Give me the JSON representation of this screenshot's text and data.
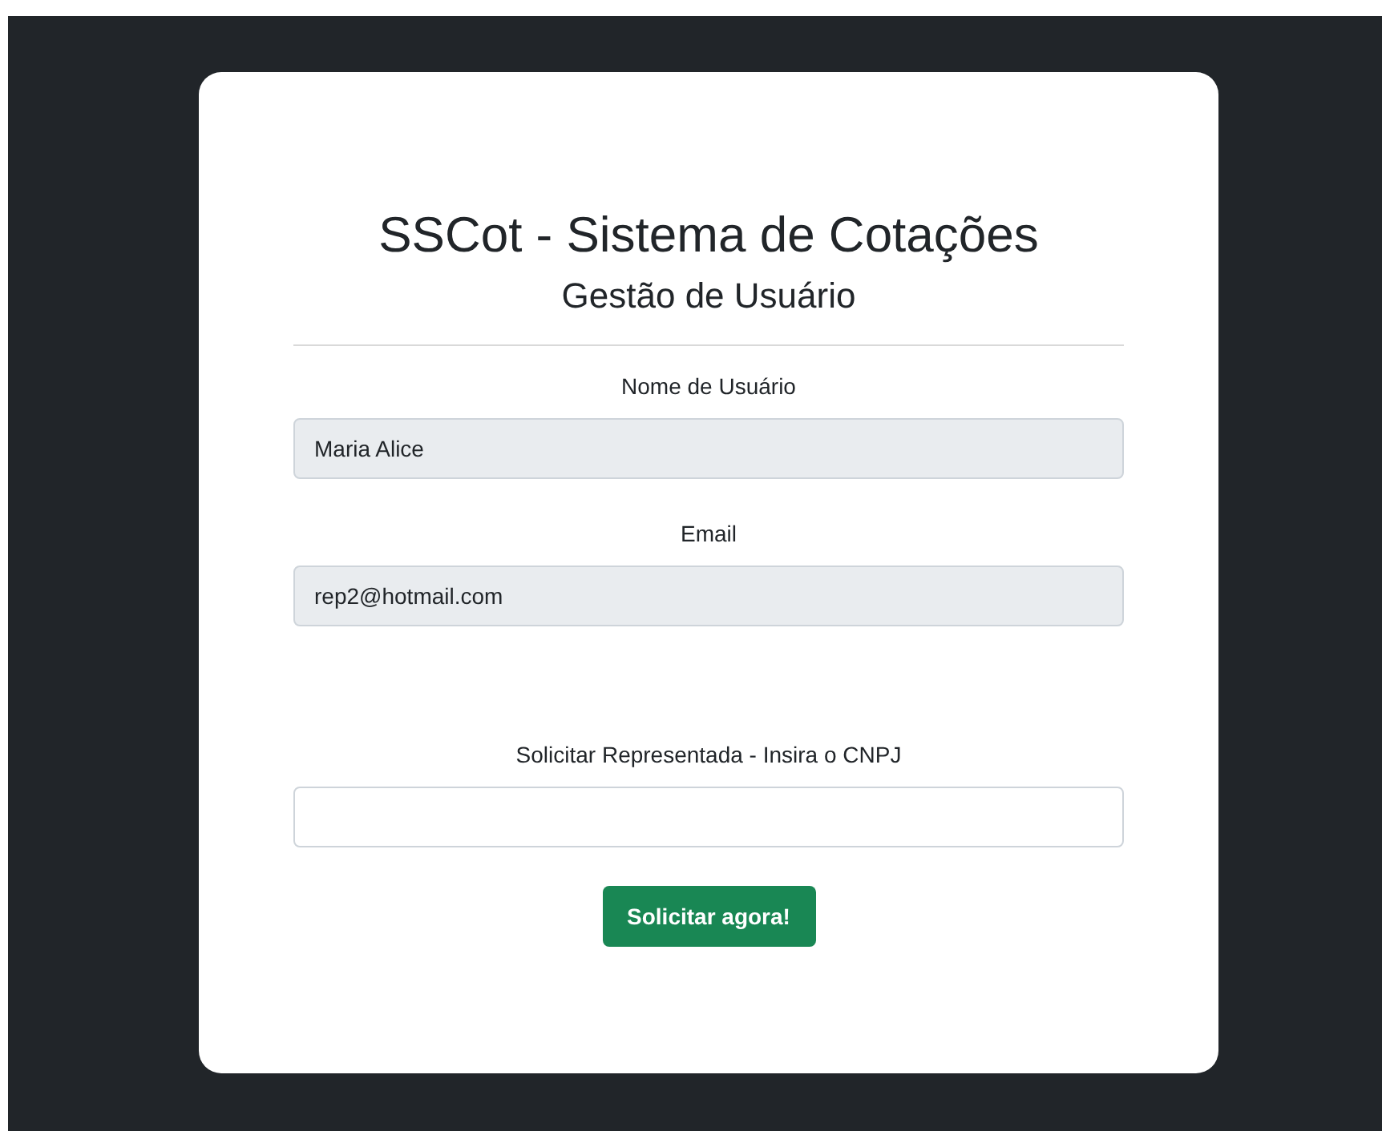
{
  "title": "SSCot - Sistema de Cotações",
  "subtitle": "Gestão de Usuário",
  "fields": [
    {
      "label": "Nome de Usuário",
      "value": "Maria Alice",
      "disabled": true
    },
    {
      "label": "Email",
      "value": "rep2@hotmail.com",
      "disabled": true
    },
    {
      "label": "Solicitar Representada - Insira o CNPJ",
      "disabled": false
    }
  ],
  "button": "Solicitar agora!"
}
